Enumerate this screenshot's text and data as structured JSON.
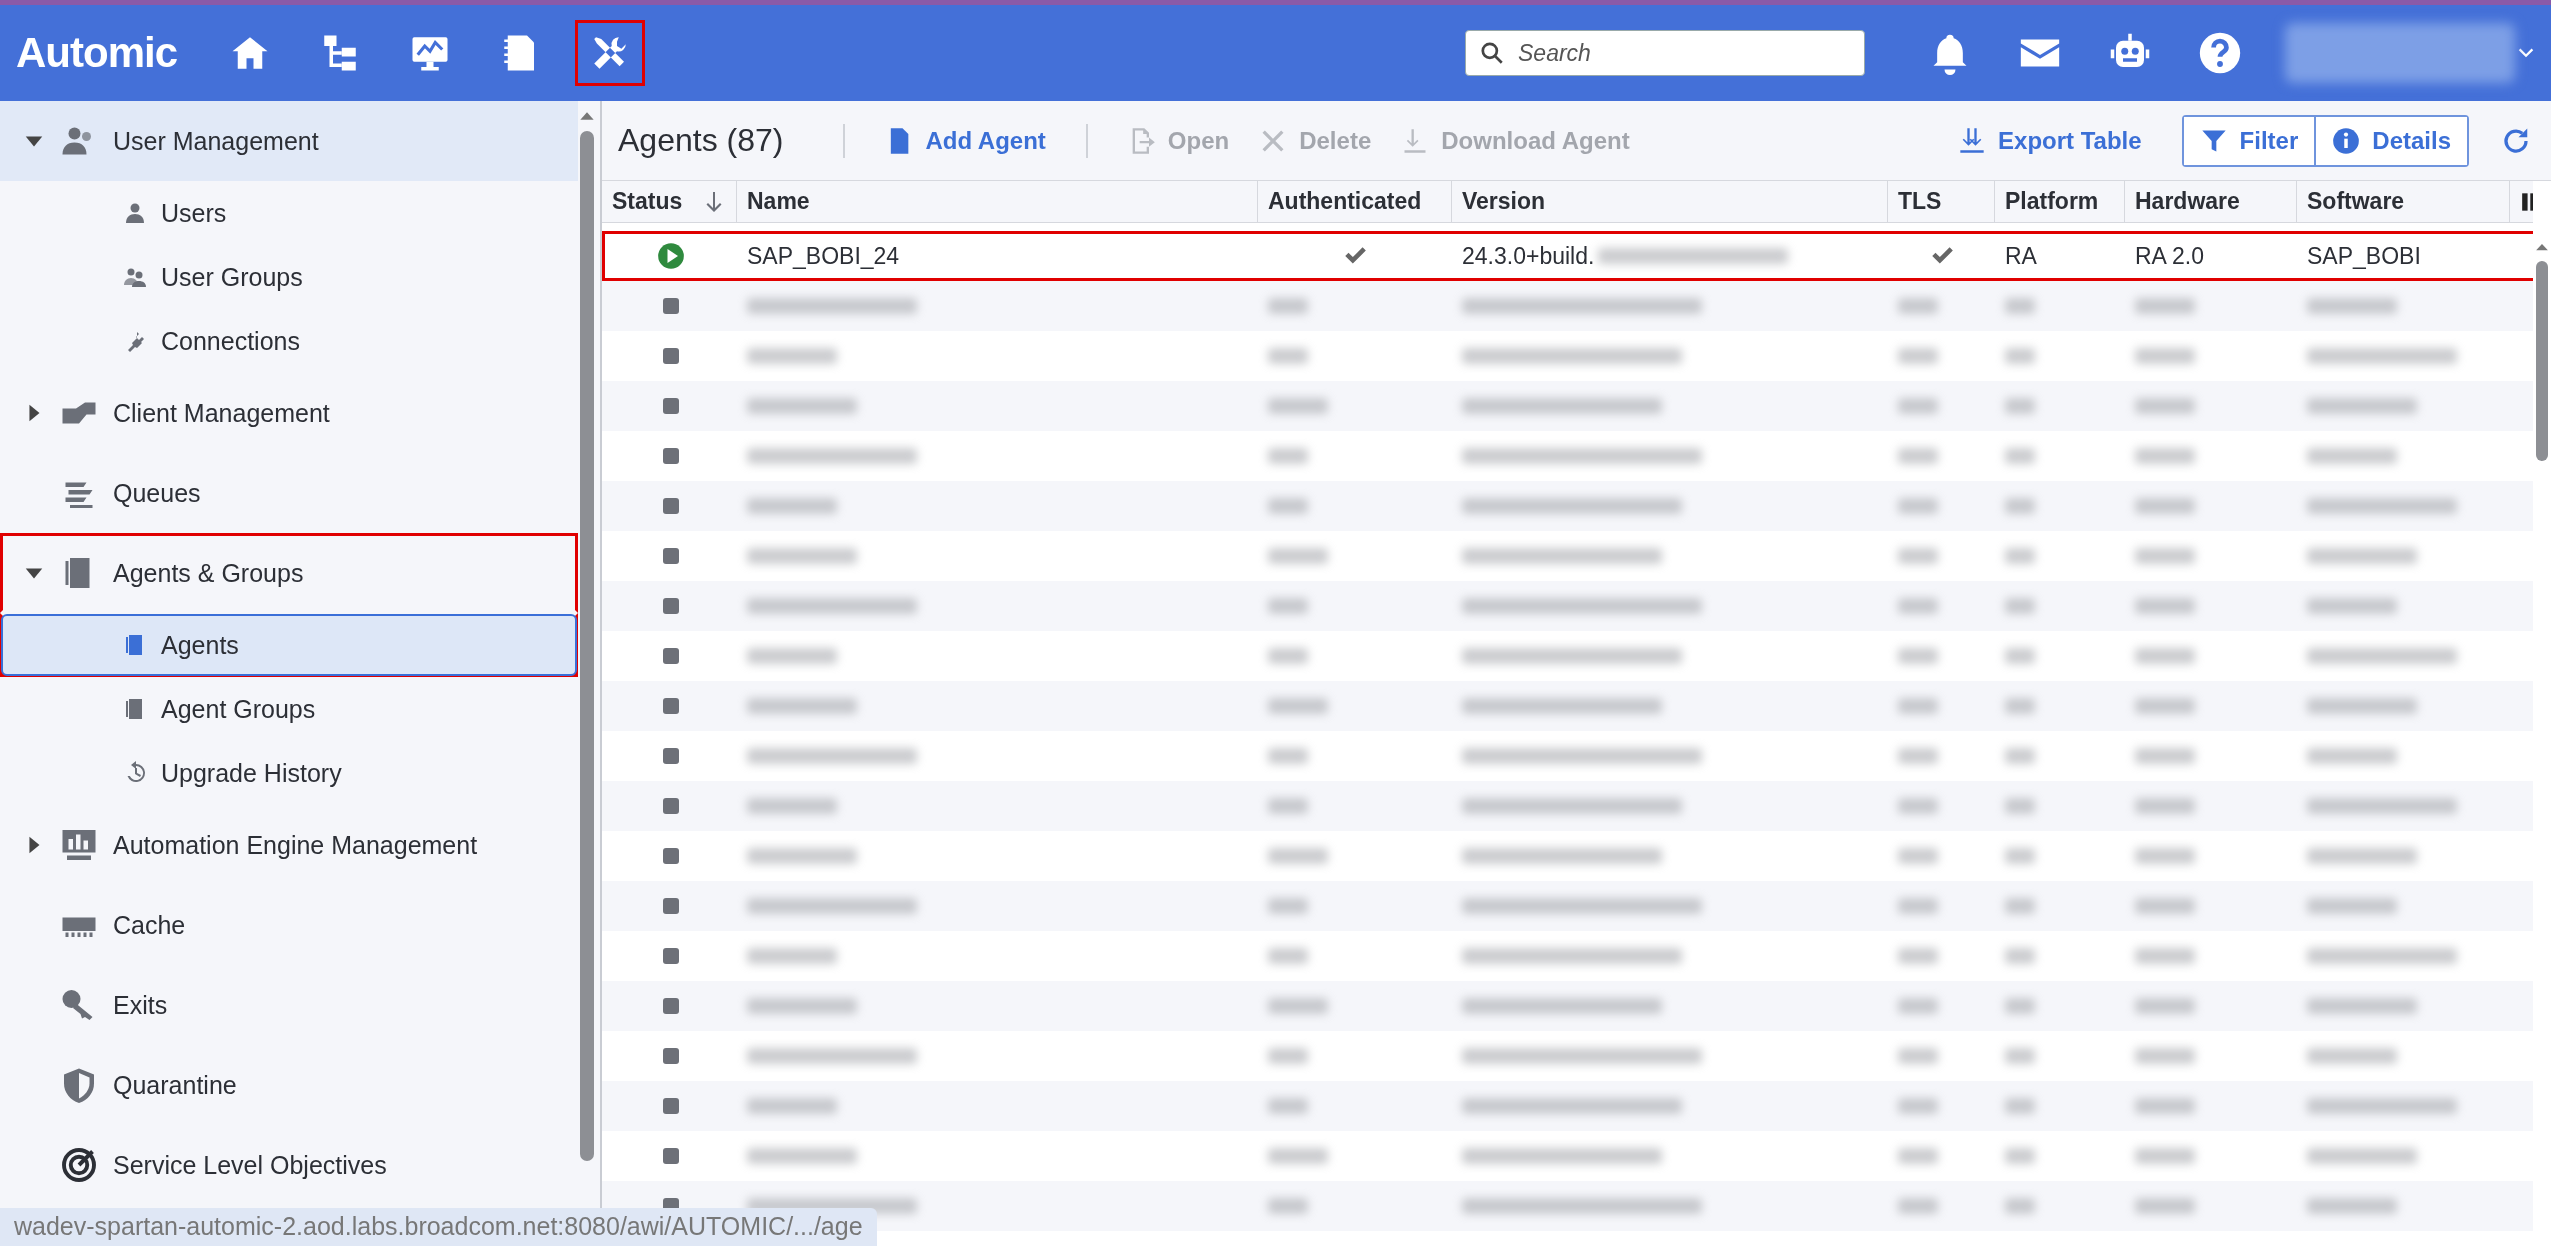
{
  "app": {
    "logo": "Automic",
    "nav": [
      {
        "annotated": false
      },
      {
        "annotated": false
      },
      {
        "annotated": false
      },
      {
        "annotated": false
      },
      {
        "annotated": true
      }
    ],
    "search": {
      "placeholder": "Search"
    }
  },
  "sidebar": {
    "items": [
      {
        "label": "User Management",
        "expanded": true,
        "hovered": true,
        "annotated": false,
        "children": [
          {
            "label": "Users",
            "selected": false,
            "annotated": false
          },
          {
            "label": "User Groups",
            "selected": false,
            "annotated": false
          },
          {
            "label": "Connections",
            "selected": false,
            "annotated": false
          }
        ]
      },
      {
        "label": "Client Management",
        "expanded": false,
        "hovered": false,
        "annotated": false
      },
      {
        "label": "Queues",
        "hovered": false,
        "annotated": false
      },
      {
        "label": "Agents & Groups",
        "expanded": true,
        "hovered": false,
        "annotated": true,
        "children": [
          {
            "label": "Agents",
            "selected": true,
            "annotated": true
          },
          {
            "label": "Agent Groups",
            "selected": false,
            "annotated": false
          },
          {
            "label": "Upgrade History",
            "selected": false,
            "annotated": false
          }
        ]
      },
      {
        "label": "Automation Engine Management",
        "expanded": false,
        "hovered": false,
        "annotated": false
      },
      {
        "label": "Cache",
        "hovered": false,
        "annotated": false
      },
      {
        "label": "Exits",
        "hovered": false,
        "annotated": false
      },
      {
        "label": "Quarantine",
        "hovered": false,
        "annotated": false
      },
      {
        "label": "Service Level Objectives",
        "hovered": false,
        "annotated": false
      }
    ]
  },
  "toolbar": {
    "title": "Agents (87)",
    "actions": [
      {
        "label": "Add Agent",
        "disabled": false
      },
      {
        "label": "Open",
        "disabled": true
      },
      {
        "label": "Delete",
        "disabled": true
      },
      {
        "label": "Download Agent",
        "disabled": true
      },
      {
        "label": "Export Table",
        "disabled": false
      }
    ],
    "toggles": [
      {
        "label": "Filter",
        "selected": false
      },
      {
        "label": "Details",
        "selected": false
      }
    ]
  },
  "table": {
    "columns": [
      "Status",
      "Name",
      "Authenticated",
      "Version",
      "TLS",
      "Platform",
      "Hardware",
      "Software"
    ],
    "rows": [
      {
        "running": true,
        "name": "SAP_BOBI_24",
        "authenticated": true,
        "version": "24.3.0+build.",
        "tls": true,
        "platform": "RA",
        "hardware": "RA 2.0",
        "software": "SAP_BOBI",
        "annotated": true,
        "redacted": false
      },
      {
        "running": false,
        "redacted": true
      },
      {
        "running": false,
        "redacted": true
      },
      {
        "running": false,
        "redacted": true
      },
      {
        "running": false,
        "redacted": true
      },
      {
        "running": false,
        "redacted": true
      },
      {
        "running": false,
        "redacted": true
      },
      {
        "running": false,
        "redacted": true
      },
      {
        "running": false,
        "redacted": true
      },
      {
        "running": false,
        "redacted": true
      },
      {
        "running": false,
        "redacted": true
      },
      {
        "running": false,
        "redacted": true
      },
      {
        "running": false,
        "redacted": true
      },
      {
        "running": false,
        "redacted": true
      },
      {
        "running": false,
        "redacted": true
      },
      {
        "running": false,
        "redacted": true
      },
      {
        "running": false,
        "redacted": true
      },
      {
        "running": false,
        "redacted": true
      },
      {
        "running": false,
        "redacted": true
      },
      {
        "running": false,
        "redacted": true
      }
    ]
  },
  "status_bar": {
    "url": "wadev-spartan-automic-2.aod.labs.broadcom.net:8080/awi/AUTOMIC/.../age"
  }
}
